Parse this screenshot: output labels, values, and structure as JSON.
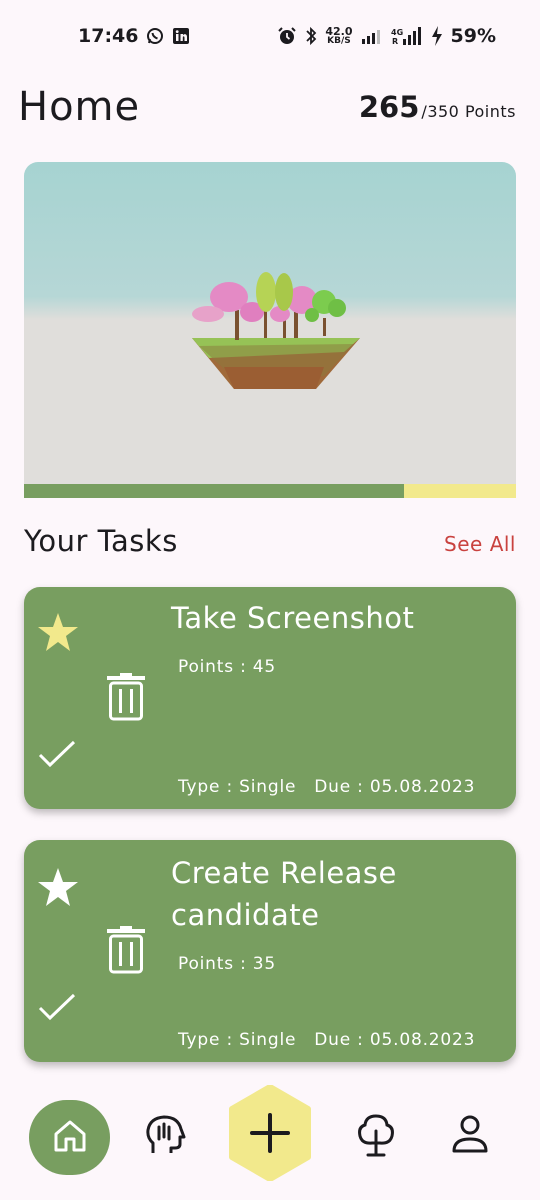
{
  "status_bar": {
    "time": "17:46",
    "net_speed_value": "42.0",
    "net_speed_unit": "KB/S",
    "battery": "59%",
    "icons": [
      "whatsapp-icon",
      "linkedin-icon",
      "alarm-icon",
      "bluetooth-icon",
      "signal-icon",
      "4g-signal-icon",
      "charging-icon"
    ]
  },
  "header": {
    "title": "Home",
    "points_current": "265",
    "points_total": "/350 Points"
  },
  "garden": {
    "progress_fraction": 0.772,
    "progress_color": "#789e60",
    "track_color": "#f2e98c"
  },
  "tasks_section": {
    "title": "Your Tasks",
    "see_all": "See All"
  },
  "tasks": [
    {
      "title": "Take Screenshot",
      "points": "Points : 45",
      "type": "Type : Single",
      "due": "Due : 05.08.2023",
      "starred": true
    },
    {
      "title": "Create Release candidate",
      "points": "Points : 35",
      "type": "Type : Single",
      "due": "Due : 05.08.2023",
      "starred": false
    }
  ],
  "bottom_nav": {
    "items": [
      "home-icon",
      "mind-icon",
      "add-icon",
      "tree-icon",
      "profile-icon"
    ]
  },
  "colors": {
    "accent_green": "#789e60",
    "accent_yellow": "#f2e98c",
    "star_yellow": "#f2e98c",
    "see_all_red": "#c9423f"
  }
}
